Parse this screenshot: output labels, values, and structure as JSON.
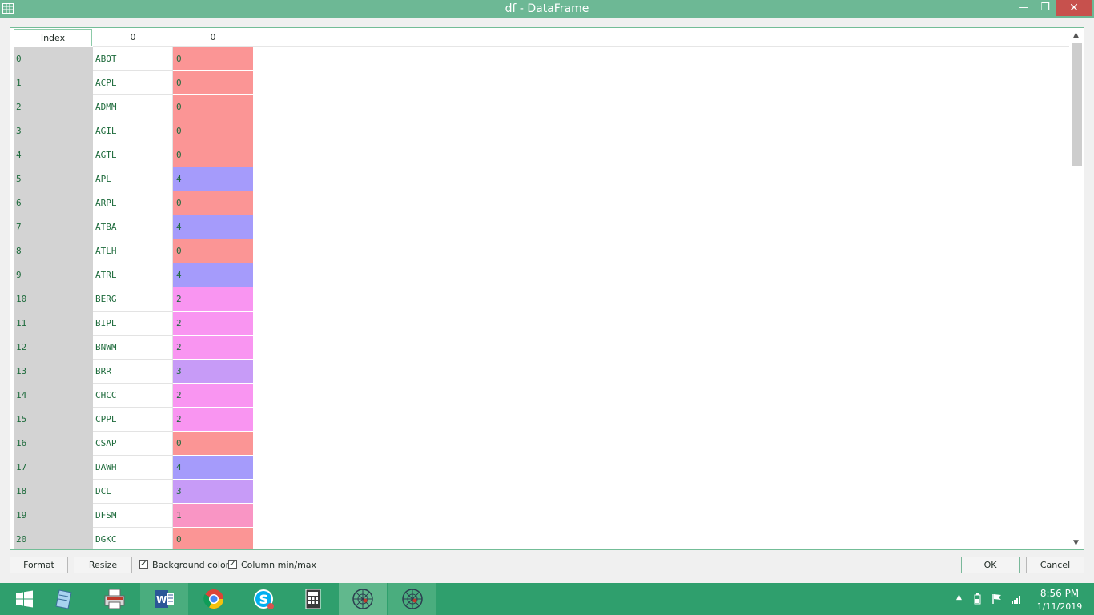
{
  "window": {
    "title": "df - DataFrame",
    "min_glyph": "—",
    "max_glyph": "❐",
    "close_glyph": "✕"
  },
  "table": {
    "index_header": "Index",
    "column_headers": [
      "0",
      "0"
    ],
    "rows": [
      {
        "index": "0",
        "name": "ABOT",
        "value": "0",
        "color": "#fb9595"
      },
      {
        "index": "1",
        "name": "ACPL",
        "value": "0",
        "color": "#fb9595"
      },
      {
        "index": "2",
        "name": "ADMM",
        "value": "0",
        "color": "#fb9595"
      },
      {
        "index": "3",
        "name": "AGIL",
        "value": "0",
        "color": "#fb9595"
      },
      {
        "index": "4",
        "name": "AGTL",
        "value": "0",
        "color": "#fb9595"
      },
      {
        "index": "5",
        "name": "APL",
        "value": "4",
        "color": "#a59bfb"
      },
      {
        "index": "6",
        "name": "ARPL",
        "value": "0",
        "color": "#fb9595"
      },
      {
        "index": "7",
        "name": "ATBA",
        "value": "4",
        "color": "#a59bfb"
      },
      {
        "index": "8",
        "name": "ATLH",
        "value": "0",
        "color": "#fb9595"
      },
      {
        "index": "9",
        "name": "ATRL",
        "value": "4",
        "color": "#a59bfb"
      },
      {
        "index": "10",
        "name": "BERG",
        "value": "2",
        "color": "#f995f1"
      },
      {
        "index": "11",
        "name": "BIPL",
        "value": "2",
        "color": "#f995f1"
      },
      {
        "index": "12",
        "name": "BNWM",
        "value": "2",
        "color": "#f995f1"
      },
      {
        "index": "13",
        "name": "BRR",
        "value": "3",
        "color": "#c79bf7"
      },
      {
        "index": "14",
        "name": "CHCC",
        "value": "2",
        "color": "#f995f1"
      },
      {
        "index": "15",
        "name": "CPPL",
        "value": "2",
        "color": "#f995f1"
      },
      {
        "index": "16",
        "name": "CSAP",
        "value": "0",
        "color": "#fb9595"
      },
      {
        "index": "17",
        "name": "DAWH",
        "value": "4",
        "color": "#a59bfb"
      },
      {
        "index": "18",
        "name": "DCL",
        "value": "3",
        "color": "#c79bf7"
      },
      {
        "index": "19",
        "name": "DFSM",
        "value": "1",
        "color": "#f995c4"
      },
      {
        "index": "20",
        "name": "DGKC",
        "value": "0",
        "color": "#fb9595"
      }
    ]
  },
  "controls": {
    "format_label": "Format",
    "resize_label": "Resize",
    "background_color_label": "Background color",
    "background_color_checked": true,
    "column_minmax_label": "Column min/max",
    "column_minmax_checked": true,
    "ok_label": "OK",
    "cancel_label": "Cancel"
  },
  "taskbar": {
    "items": [
      "windows-start-icon",
      "notepad-icon",
      "printer-icon",
      "word-icon",
      "chrome-icon",
      "skype-icon",
      "calculator-icon",
      "spyder-icon",
      "spyder-icon"
    ],
    "time": "8:56 PM",
    "date": "1/11/2019"
  },
  "colors": {
    "titlebar": "#6db895",
    "taskbar": "#2f9f6d",
    "close": "#c7514d",
    "text_green": "#1e6b3c"
  }
}
